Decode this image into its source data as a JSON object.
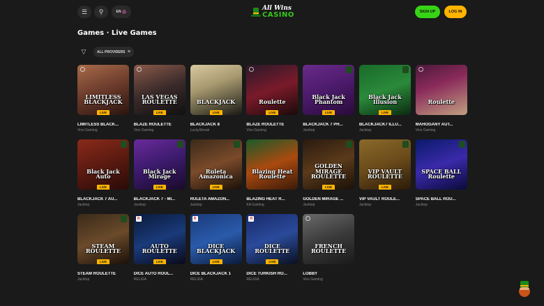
{
  "header": {
    "menu_icon": "hamburger-menu-icon",
    "search_icon": "search-icon",
    "language": "EN",
    "logo_top": "All Wins",
    "logo_bottom": "CASINO",
    "signup_label": "SIGN UP",
    "login_label": "LOG IN"
  },
  "page": {
    "title": "Games · Live Games",
    "filter_icon": "filter-icon",
    "providers_label": "ALL PROVIDERS",
    "providers_icon": "sliders-icon"
  },
  "badge_label": "LIVE",
  "colors": {
    "background": "#1a1a1a",
    "accent_green": "#37d416",
    "accent_yellow": "#ffb400"
  },
  "games": [
    {
      "name": "LIMITLESS BLACK...",
      "provider": "Vivo Gaming",
      "art": "LIMITLESS BLACKJACK",
      "live": true,
      "bg": "linear-gradient(160deg,#a86b4a 0%,#6a3a2a 50%,#2a1410 100%)"
    },
    {
      "name": "BLAZE ROULETTE",
      "provider": "Vivo Gaming",
      "art": "LAS VEGAS ROULETTE",
      "live": true,
      "bg": "linear-gradient(160deg,#8a5a4a 0%,#3a2a2a 50%,#101010 100%)"
    },
    {
      "name": "BLACKJACK 8",
      "provider": "LuckyStreak",
      "art": "BLACKJACK",
      "live": true,
      "bg": "linear-gradient(160deg,#d8c8a0 0%,#a89a70 40%,#1a1a14 100%)"
    },
    {
      "name": "BLAZE ROULETTE",
      "provider": "Vivo Gaming",
      "art": "Roulette",
      "live": true,
      "bg": "linear-gradient(160deg,#2a1a2a 0%,#7a1a2a 50%,#1a0a0a 100%)"
    },
    {
      "name": "BLACKJACK 7 PH...",
      "provider": "Jacktop",
      "art": "Black Jack Phantom",
      "live": true,
      "bg": "linear-gradient(160deg,#6a2a8a 0%,#4a1a6a 50%,#2a0a3a 100%)"
    },
    {
      "name": "BLACKJACK7 ILLU...",
      "provider": "Jacktop",
      "art": "Black Jack Illusion",
      "live": true,
      "bg": "linear-gradient(160deg,#1a6a2a 0%,#2a8a3a 50%,#0a2a10 100%)"
    },
    {
      "name": "MAHOGANY AUT...",
      "provider": "Vivo Gaming",
      "art": "Roulette",
      "live": false,
      "bg": "linear-gradient(160deg,#4a1a3a 0%,#8a2a5a 40%,#c0a080 100%)"
    },
    {
      "name": "BLACKJACK 7 AU...",
      "provider": "Jacktop",
      "art": "Black Jack Auto",
      "live": true,
      "bg": "linear-gradient(160deg,#8a2a1a 0%,#5a1a10 50%,#2a0a08 100%)"
    },
    {
      "name": "BLACKJACK 7 - MI...",
      "provider": "Jacktop",
      "art": "Black Jack Mirage",
      "live": true,
      "bg": "linear-gradient(160deg,#6a2a9a 0%,#3a1a6a 50%,#1a0a2a 100%)"
    },
    {
      "name": "RULETA AMAZON...",
      "provider": "Jacktop",
      "art": "Ruleta Amazonica",
      "live": true,
      "bg": "linear-gradient(160deg,#3a2a1a 0%,#7a4a2a 50%,#1a1008 100%)"
    },
    {
      "name": "BLAZING HEAT R...",
      "provider": "KA Gaming",
      "art": "Blazing Heat Roulette",
      "live": false,
      "bg": "linear-gradient(160deg,#1a5a2a 0%,#aa4a10 50%,#3a1a08 100%)"
    },
    {
      "name": "GOLDEN MIRAGE ...",
      "provider": "Jacktop",
      "art": "GOLDEN MIRAGE ROULETTE",
      "live": true,
      "bg": "linear-gradient(160deg,#2a1a10 0%,#5a3a1a 50%,#1a1008 100%)"
    },
    {
      "name": "VIP VAULT ROULE...",
      "provider": "Jacktop",
      "art": "VIP VAULT ROULETTE",
      "live": true,
      "bg": "linear-gradient(160deg,#8a6a2a 0%,#6a4a1a 50%,#2a1a08 100%)"
    },
    {
      "name": "SPACE BALL ROU...",
      "provider": "Jacktop",
      "art": "SPACE BALL Roulette",
      "live": false,
      "bg": "linear-gradient(160deg,#0a1a6a 0%,#3a2aaa 50%,#0a0a3a 100%)"
    },
    {
      "name": "STEAM ROULETTE",
      "provider": "Jacktop",
      "art": "STEAM ROULETTE",
      "live": true,
      "bg": "linear-gradient(160deg,#3a2a1a 0%,#6a4a2a 50%,#1a1008 100%)"
    },
    {
      "name": "DICE AUTO ROUL...",
      "provider": "RELIGA",
      "art": "AUTO ROULETTE",
      "live": true,
      "bg": "linear-gradient(160deg,#0a1a3a 0%,#1a3a7a 50%,#0a0a1a 100%)"
    },
    {
      "name": "DICE BLACKJACK 1",
      "provider": "RELIGA",
      "art": "DICE BLACKJACK",
      "live": true,
      "bg": "linear-gradient(160deg,#1a3a7a 0%,#2a5aaa 50%,#0a1a3a 100%)"
    },
    {
      "name": "DICE TURKISH RO...",
      "provider": "RELIGA",
      "art": "DICE ROULETTE",
      "live": true,
      "bg": "linear-gradient(160deg,#1a2a6a 0%,#2a4a9a 50%,#0a1020 100%)"
    },
    {
      "name": "LOBBY",
      "provider": "Vivo Gaming",
      "art": "FRENCH ROULETTE",
      "live": false,
      "bg": "linear-gradient(160deg,#6a6a6a 0%,#3a3a3a 50%,#1a1a1a 100%)"
    }
  ]
}
